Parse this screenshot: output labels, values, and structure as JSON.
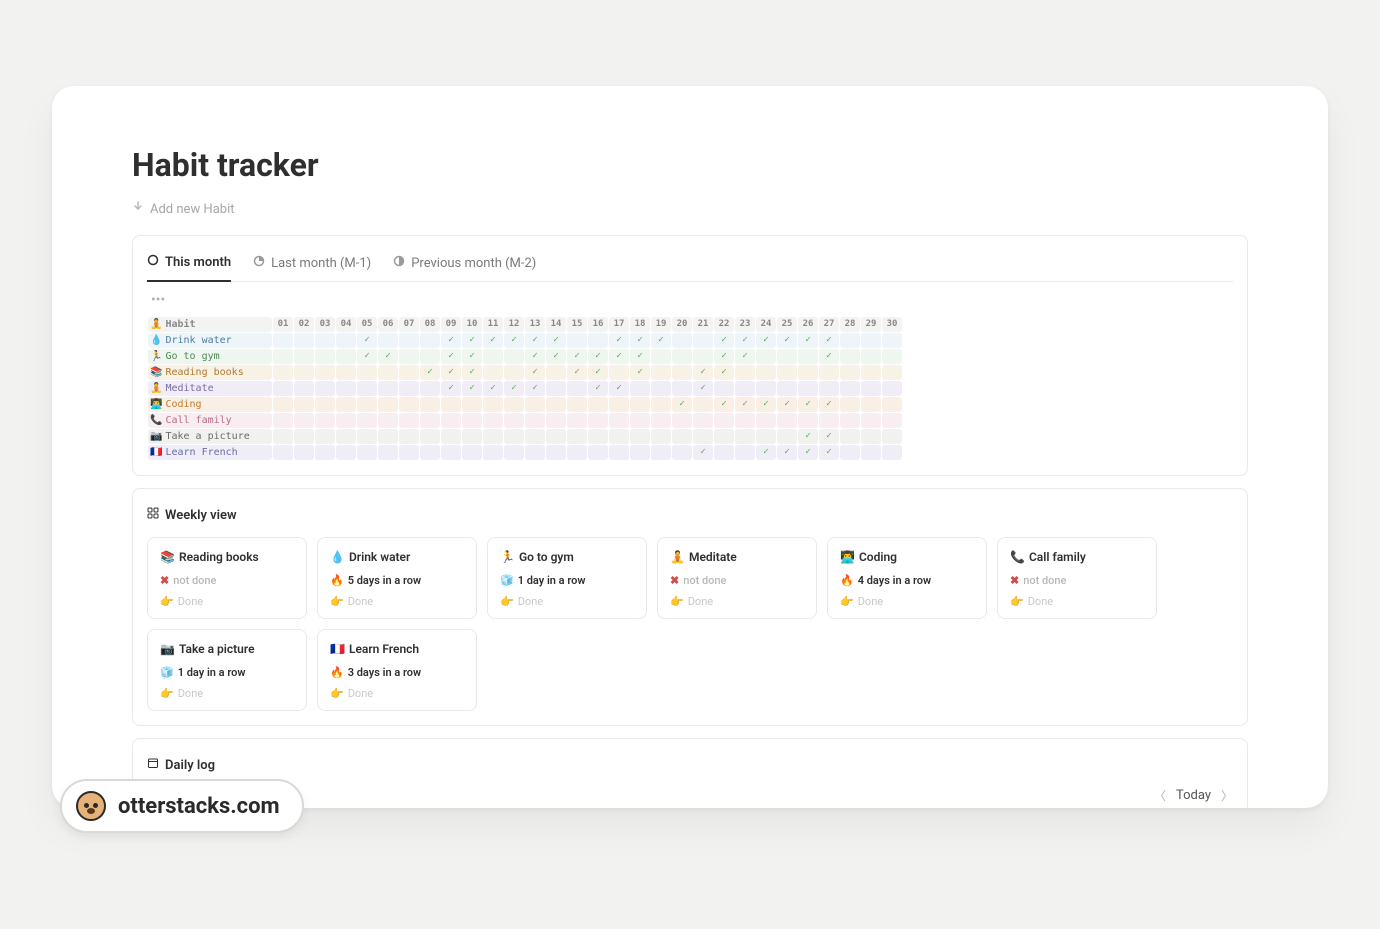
{
  "page": {
    "title": "Habit tracker",
    "add_habit": "Add new Habit"
  },
  "tabs": [
    {
      "label": "This month",
      "active": true
    },
    {
      "label": "Last month (M-1)",
      "active": false
    },
    {
      "label": "Previous month (M-2)",
      "active": false
    }
  ],
  "grid": {
    "header_label": "Habit",
    "header_emoji": "🧘",
    "days": [
      "01",
      "02",
      "03",
      "04",
      "05",
      "06",
      "07",
      "08",
      "09",
      "10",
      "11",
      "12",
      "13",
      "14",
      "15",
      "16",
      "17",
      "18",
      "19",
      "20",
      "21",
      "22",
      "23",
      "24",
      "25",
      "26",
      "27",
      "28",
      "29",
      "30"
    ],
    "rows": [
      {
        "key": "drink",
        "emoji": "💧",
        "name": "Drink water",
        "checks": [
          5,
          9,
          10,
          11,
          12,
          13,
          14,
          17,
          18,
          19,
          22,
          23,
          24,
          25,
          26,
          27
        ]
      },
      {
        "key": "gym",
        "emoji": "🏃",
        "name": "Go to gym",
        "checks": [
          5,
          6,
          9,
          10,
          13,
          14,
          15,
          16,
          17,
          18,
          22,
          23,
          27
        ]
      },
      {
        "key": "read",
        "emoji": "📚",
        "name": "Reading books",
        "checks": [
          8,
          9,
          10,
          13,
          15,
          16,
          18,
          21,
          22
        ]
      },
      {
        "key": "meditate",
        "emoji": "🧘",
        "name": "Meditate",
        "checks": [
          9,
          10,
          11,
          12,
          13,
          16,
          17,
          21
        ]
      },
      {
        "key": "coding",
        "emoji": "👨‍💻",
        "name": "Coding",
        "checks": [
          20,
          22,
          23,
          24,
          25,
          26,
          27
        ]
      },
      {
        "key": "call",
        "emoji": "📞",
        "name": "Call family",
        "checks": []
      },
      {
        "key": "photo",
        "emoji": "📷",
        "name": "Take a picture",
        "checks": [
          26,
          27
        ]
      },
      {
        "key": "french",
        "emoji": "🇫🇷",
        "name": "Learn French",
        "checks": [
          21,
          24,
          25,
          26,
          27
        ]
      }
    ]
  },
  "weekly": {
    "title": "Weekly view",
    "done_label": "Done",
    "notdone_label": "not done",
    "cards": [
      {
        "emoji": "📚",
        "title": "Reading books",
        "status": "notdone",
        "status_text": "not done"
      },
      {
        "emoji": "💧",
        "title": "Drink water",
        "status": "streak",
        "status_text": "5 days in a row"
      },
      {
        "emoji": "🏃",
        "title": "Go to gym",
        "status": "cool",
        "status_text": "1 day in a row"
      },
      {
        "emoji": "🧘",
        "title": "Meditate",
        "status": "notdone",
        "status_text": "not done"
      },
      {
        "emoji": "👨‍💻",
        "title": "Coding",
        "status": "streak",
        "status_text": "4 days in a row"
      },
      {
        "emoji": "📞",
        "title": "Call family",
        "status": "notdone",
        "status_text": "not done"
      },
      {
        "emoji": "📷",
        "title": "Take a picture",
        "status": "cool",
        "status_text": "1 day in a row"
      },
      {
        "emoji": "🇫🇷",
        "title": "Learn French",
        "status": "streak",
        "status_text": "3 days in a row"
      }
    ]
  },
  "dailylog": {
    "title": "Daily log",
    "today": "Today"
  },
  "watermark": "otterstacks.com"
}
